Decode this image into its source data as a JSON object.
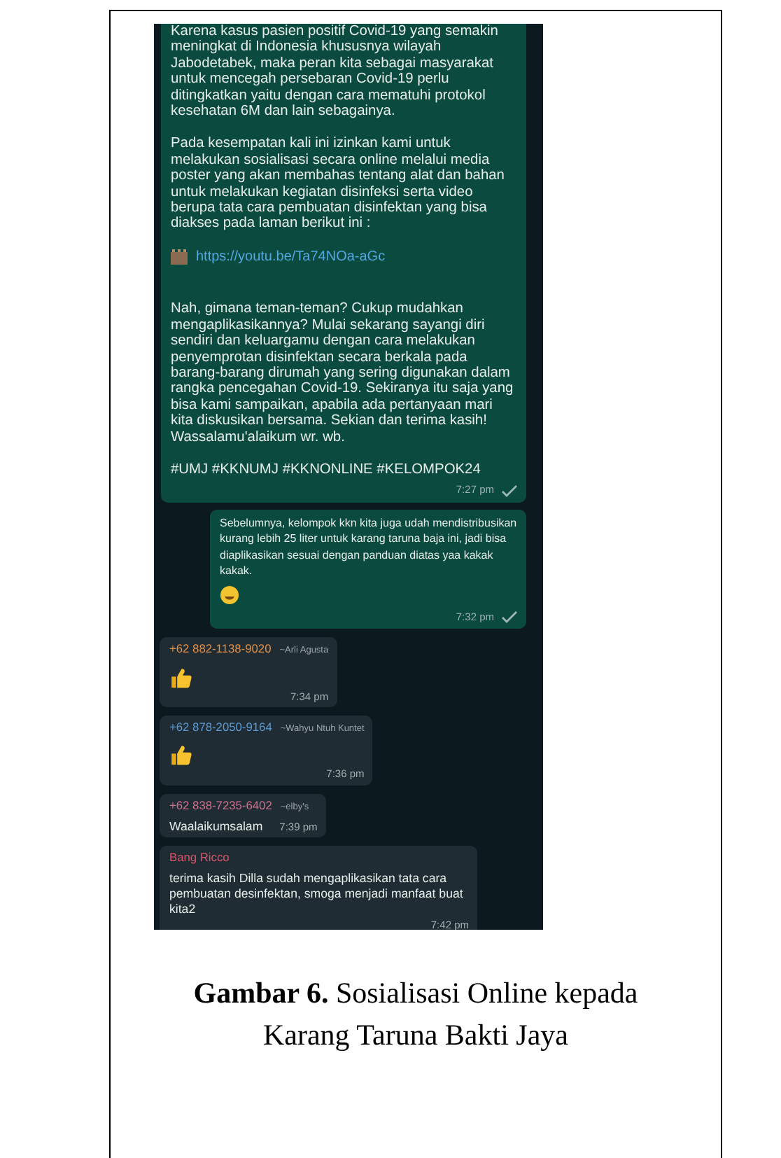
{
  "chat": {
    "messages": [
      {
        "kind": "outgoing",
        "sent": true,
        "time": "7:27 pm",
        "parts": [
          {
            "kind": "paragraph",
            "text": "Karena kasus pasien positif Covid-19 yang semakin meningkat di Indonesia khususnya wilayah Jabodetabek, maka peran kita sebagai masyarakat untuk mencegah persebaran Covid-19 perlu ditingkatkan yaitu dengan cara mematuhi protokol kesehatan 6M dan lain sebagainya."
          },
          {
            "kind": "paragraph",
            "text": "Pada kesempatan kali ini izinkan kami untuk melakukan sosialisasi secara online melalui media poster yang akan membahas tentang alat dan bahan untuk melakukan kegiatan disinfeksi serta video berupa tata cara pembuatan disinfektan yang bisa diakses pada laman berikut ini :"
          },
          {
            "kind": "link",
            "text": "https://youtu.be/Ta74NOa-aGc"
          },
          {
            "kind": "paragraph",
            "text": "Nah, gimana teman-teman? Cukup mudahkan mengaplikasikannya? Mulai sekarang sayangi diri sendiri dan keluargamu dengan cara melakukan penyemprotan disinfektan secara berkala pada barang-barang dirumah yang sering digunakan dalam rangka pencegahan Covid-19. Sekiranya itu saja yang bisa kami sampaikan, apabila ada pertanyaan mari kita diskusikan bersama. Sekian dan terima kasih! Wassalamu'alaikum wr. wb."
          },
          {
            "kind": "paragraph",
            "text": "#UMJ #KKNUMJ #KKNONLINE #KELOMPOK24"
          }
        ]
      },
      {
        "kind": "outgoing",
        "sent": true,
        "time": "7:32 pm",
        "parts": [
          {
            "kind": "paragraph",
            "text": "Sebelumnya, kelompok kkn kita juga udah mendistribusikan kurang lebih 25 liter untuk karang taruna baja ini, jadi bisa diaplikasikan sesuai dengan panduan diatas yaa kakak kakak."
          },
          {
            "kind": "smile"
          }
        ]
      },
      {
        "kind": "incoming",
        "sender": "+62 882-1138-9020",
        "alias": "~Arli Agusta",
        "color": "#e0904a",
        "time": "7:34 pm",
        "parts": [
          {
            "kind": "thumbs"
          }
        ]
      },
      {
        "kind": "incoming",
        "sender": "+62 878-2050-9164",
        "alias": "~Wahyu Ntuh Kuntet",
        "color": "#5b9bd5",
        "time": "7:36 pm",
        "parts": [
          {
            "kind": "thumbs"
          }
        ]
      },
      {
        "kind": "incoming",
        "sender": "+62 838-7235-6402",
        "alias": "~elby's",
        "color": "#d0708f",
        "time": "7:39 pm",
        "inline_time": true,
        "parts": [
          {
            "kind": "paragraph",
            "text": "Waalaikumsalam"
          }
        ]
      },
      {
        "kind": "incoming",
        "sender": "Bang Ricco",
        "color": "#d9536a",
        "time": "7:42 pm",
        "parts": [
          {
            "kind": "paragraph",
            "text": "terima kasih Dilla sudah mengaplikasikan tata cara pembuatan desinfektan, smoga menjadi manfaat buat kita2"
          }
        ]
      }
    ]
  },
  "caption": {
    "label": "Gambar 6.",
    "text": "Sosialisasi Online kepada Karang Taruna Bakti Jaya"
  }
}
